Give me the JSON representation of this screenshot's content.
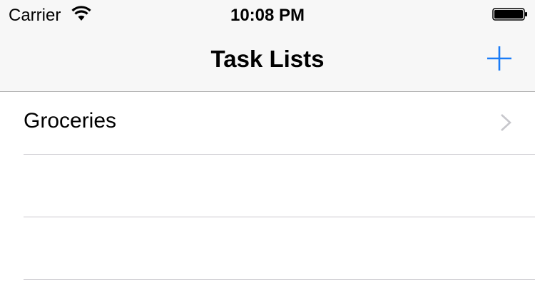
{
  "status_bar": {
    "carrier": "Carrier",
    "time": "10:08 PM"
  },
  "nav_bar": {
    "title": "Task Lists",
    "add_icon": "plus-icon"
  },
  "task_lists": [
    {
      "name": "Groceries",
      "accessory": "chevron-right-icon"
    },
    {
      "name": ""
    },
    {
      "name": ""
    }
  ],
  "colors": {
    "tint": "#1a7cf7",
    "bar_background": "#f7f7f7",
    "separator": "#c8c7cc",
    "chevron": "#c7c7cc"
  }
}
